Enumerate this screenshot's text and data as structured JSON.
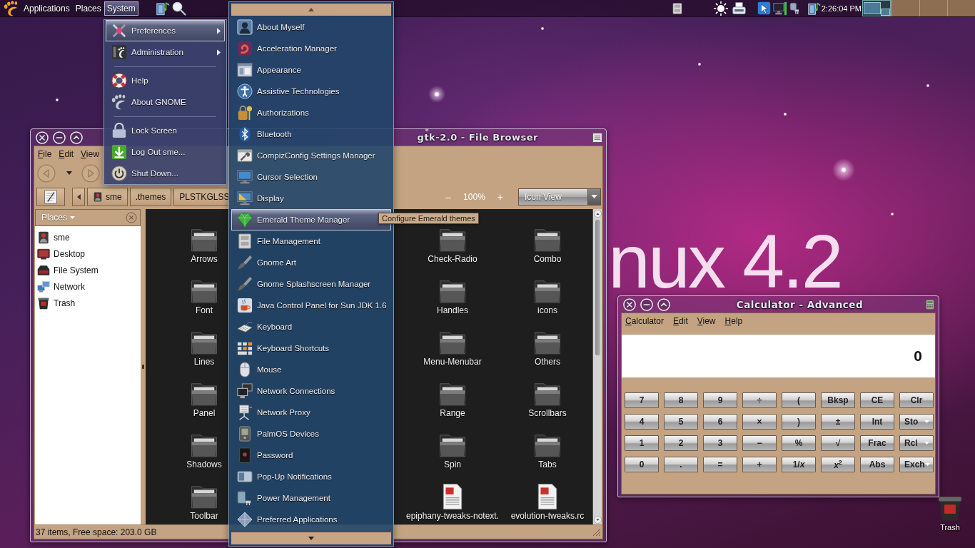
{
  "panel": {
    "menus": [
      {
        "label": "Applications",
        "selected": false
      },
      {
        "label": "Places",
        "selected": false
      },
      {
        "label": "System",
        "selected": true
      }
    ],
    "clock": "2:26:04 PM",
    "workspaces": [
      {
        "selected": true
      },
      {
        "selected": false
      },
      {
        "selected": false
      },
      {
        "selected": false
      }
    ]
  },
  "wallpaper": {
    "text": "nux 4.2"
  },
  "file_browser": {
    "title": "gtk-2.0 - File Browser",
    "menu_bar": [
      "File",
      "Edit",
      "View"
    ],
    "path": [
      "sme",
      ".themes",
      "PLSTKGLSS"
    ],
    "zoom_out": "–",
    "zoom_level": "100%",
    "zoom_in": "+",
    "view_mode": "Icon View",
    "sidebar": {
      "title": "Places",
      "items": [
        "sme",
        "Desktop",
        "File System",
        "Network",
        "Trash"
      ]
    },
    "items": [
      {
        "label": "Arrows",
        "kind": "folder"
      },
      {
        "label": "Check-Radio",
        "kind": "folder"
      },
      {
        "label": "Combo",
        "kind": "folder"
      },
      {
        "label": "Font",
        "kind": "folder"
      },
      {
        "label": "Handles",
        "kind": "folder"
      },
      {
        "label": "icons",
        "kind": "folder"
      },
      {
        "label": "Lines",
        "kind": "folder"
      },
      {
        "label": "Menu-Menubar",
        "kind": "folder"
      },
      {
        "label": "Others",
        "kind": "folder"
      },
      {
        "label": "Panel",
        "kind": "folder"
      },
      {
        "label": "Range",
        "kind": "folder"
      },
      {
        "label": "Scrollbars",
        "kind": "folder"
      },
      {
        "label": "Shadows",
        "kind": "folder"
      },
      {
        "label": "Spin",
        "kind": "folder"
      },
      {
        "label": "Tabs",
        "kind": "folder"
      },
      {
        "label": "Toolbar",
        "kind": "folder"
      },
      {
        "label": "epiphany-tweaks-notext.",
        "kind": "file"
      },
      {
        "label": "evolution-tweaks.rc",
        "kind": "file"
      }
    ],
    "status": "37 items, Free space: 203.0 GB"
  },
  "system_menu": [
    {
      "kind": "item",
      "label": "Preferences",
      "submenu": true,
      "selected": true
    },
    {
      "kind": "item",
      "label": "Administration",
      "submenu": true,
      "selected": false
    },
    {
      "kind": "separator"
    },
    {
      "kind": "item",
      "label": "Help",
      "submenu": false,
      "selected": false
    },
    {
      "kind": "item",
      "label": "About GNOME",
      "submenu": false,
      "selected": false
    },
    {
      "kind": "separator"
    },
    {
      "kind": "item",
      "label": "Lock Screen",
      "submenu": false,
      "selected": false
    },
    {
      "kind": "item",
      "label": "Log Out sme...",
      "submenu": false,
      "selected": false
    },
    {
      "kind": "item",
      "label": "Shut Down...",
      "submenu": false,
      "selected": false
    }
  ],
  "preferences_menu": [
    {
      "label": "About Myself",
      "selected": false
    },
    {
      "label": "Acceleration Manager",
      "selected": false
    },
    {
      "label": "Appearance",
      "selected": false
    },
    {
      "label": "Assistive Technologies",
      "selected": false
    },
    {
      "label": "Authorizations",
      "selected": false
    },
    {
      "label": "Bluetooth",
      "selected": false
    },
    {
      "label": "CompizConfig Settings Manager",
      "selected": false
    },
    {
      "label": "Cursor Selection",
      "selected": false
    },
    {
      "label": "Display",
      "selected": false
    },
    {
      "label": "Emerald Theme Manager",
      "selected": true
    },
    {
      "label": "File Management",
      "selected": false
    },
    {
      "label": "Gnome Art",
      "selected": false
    },
    {
      "label": "Gnome Splashscreen Manager",
      "selected": false
    },
    {
      "label": "Java Control Panel for Sun JDK 1.6",
      "selected": false
    },
    {
      "label": "Keyboard",
      "selected": false
    },
    {
      "label": "Keyboard Shortcuts",
      "selected": false
    },
    {
      "label": "Mouse",
      "selected": false
    },
    {
      "label": "Network Connections",
      "selected": false
    },
    {
      "label": "Network Proxy",
      "selected": false
    },
    {
      "label": "PalmOS Devices",
      "selected": false
    },
    {
      "label": "Password",
      "selected": false
    },
    {
      "label": "Pop-Up Notifications",
      "selected": false
    },
    {
      "label": "Power Management",
      "selected": false
    },
    {
      "label": "Preferred Applications",
      "selected": false
    }
  ],
  "tooltip": "Configure Emerald themes",
  "calculator": {
    "title": "Calculator - Advanced",
    "menu_bar": [
      "Calculator",
      "Edit",
      "View",
      "Help"
    ],
    "display": "0",
    "buttons": [
      {
        "label": "7",
        "kind": "plain"
      },
      {
        "label": "8",
        "kind": "plain"
      },
      {
        "label": "9",
        "kind": "plain"
      },
      {
        "label": "÷",
        "kind": "plain"
      },
      {
        "label": "(",
        "kind": "plain"
      },
      {
        "label": "Bksp",
        "kind": "plain"
      },
      {
        "label": "CE",
        "kind": "plain"
      },
      {
        "label": "Clr",
        "kind": "plain"
      },
      {
        "label": "4",
        "kind": "plain"
      },
      {
        "label": "5",
        "kind": "plain"
      },
      {
        "label": "6",
        "kind": "plain"
      },
      {
        "label": "×",
        "kind": "plain"
      },
      {
        "label": ")",
        "kind": "plain"
      },
      {
        "label": "±",
        "kind": "plain"
      },
      {
        "label": "Int",
        "kind": "plain"
      },
      {
        "label": "Sto",
        "kind": "menu"
      },
      {
        "label": "1",
        "kind": "plain"
      },
      {
        "label": "2",
        "kind": "plain"
      },
      {
        "label": "3",
        "kind": "plain"
      },
      {
        "label": "−",
        "kind": "plain"
      },
      {
        "label": "%",
        "kind": "plain"
      },
      {
        "label": "√",
        "kind": "plain"
      },
      {
        "label": "Frac",
        "kind": "plain"
      },
      {
        "label": "Rcl",
        "kind": "menu"
      },
      {
        "label": "0",
        "kind": "plain"
      },
      {
        "label": ".",
        "kind": "plain"
      },
      {
        "label": "=",
        "kind": "plain"
      },
      {
        "label": "+",
        "kind": "plain"
      },
      {
        "label": "1/*x*",
        "kind": "plain"
      },
      {
        "label": "*x*$^{2}$",
        "kind": "plain"
      },
      {
        "label": "Abs",
        "kind": "plain"
      },
      {
        "label": "Exch",
        "kind": "menu"
      }
    ]
  },
  "desktop_icons": [
    {
      "label": "Trash"
    }
  ]
}
